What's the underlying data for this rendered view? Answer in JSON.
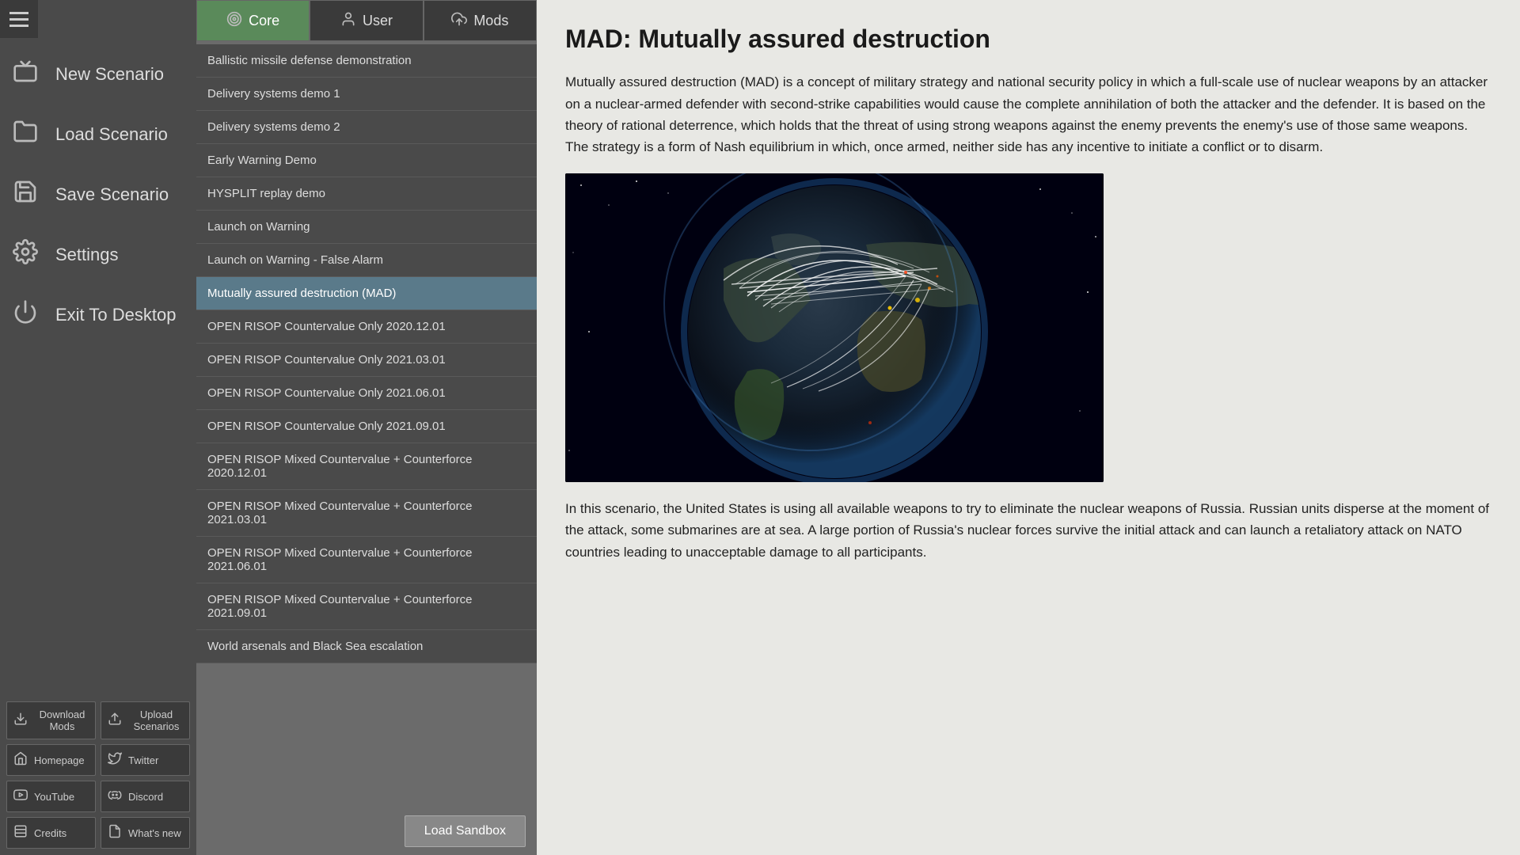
{
  "sidebar": {
    "nav_items": [
      {
        "id": "new-scenario",
        "label": "New Scenario",
        "icon": "box"
      },
      {
        "id": "load-scenario",
        "label": "Load Scenario",
        "icon": "folder"
      },
      {
        "id": "save-scenario",
        "label": "Save Scenario",
        "icon": "floppy"
      },
      {
        "id": "settings",
        "label": "Settings",
        "icon": "gear"
      },
      {
        "id": "exit-desktop",
        "label": "Exit To Desktop",
        "icon": "power"
      }
    ],
    "bottom_buttons": [
      [
        {
          "id": "download-mods",
          "label": "Download Mods",
          "icon": "download"
        },
        {
          "id": "upload-scenarios",
          "label": "Upload Scenarios",
          "icon": "upload"
        }
      ],
      [
        {
          "id": "homepage",
          "label": "Homepage",
          "icon": "home"
        },
        {
          "id": "twitter",
          "label": "Twitter",
          "icon": "twitter"
        }
      ],
      [
        {
          "id": "youtube",
          "label": "YouTube",
          "icon": "youtube"
        },
        {
          "id": "discord",
          "label": "Discord",
          "icon": "discord"
        }
      ],
      [
        {
          "id": "credits",
          "label": "Credits",
          "icon": "credits"
        },
        {
          "id": "whats-new",
          "label": "What's new",
          "icon": "document"
        }
      ]
    ]
  },
  "tabs": [
    {
      "id": "core",
      "label": "Core",
      "icon": "target",
      "active": true
    },
    {
      "id": "user",
      "label": "User",
      "icon": "user"
    },
    {
      "id": "mods",
      "label": "Mods",
      "icon": "cloud-upload"
    }
  ],
  "scenarios": [
    {
      "id": 1,
      "label": "Ballistic missile defense demonstration",
      "selected": false
    },
    {
      "id": 2,
      "label": "Delivery systems demo 1",
      "selected": false
    },
    {
      "id": 3,
      "label": "Delivery systems demo 2",
      "selected": false
    },
    {
      "id": 4,
      "label": "Early Warning Demo",
      "selected": false
    },
    {
      "id": 5,
      "label": "HYSPLIT replay demo",
      "selected": false
    },
    {
      "id": 6,
      "label": "Launch on Warning",
      "selected": false
    },
    {
      "id": 7,
      "label": "Launch on Warning - False Alarm",
      "selected": false
    },
    {
      "id": 8,
      "label": "Mutually assured destruction (MAD)",
      "selected": true
    },
    {
      "id": 9,
      "label": "OPEN RISOP Countervalue Only 2020.12.01",
      "selected": false
    },
    {
      "id": 10,
      "label": "OPEN RISOP Countervalue Only 2021.03.01",
      "selected": false
    },
    {
      "id": 11,
      "label": "OPEN RISOP Countervalue Only 2021.06.01",
      "selected": false
    },
    {
      "id": 12,
      "label": "OPEN RISOP Countervalue Only 2021.09.01",
      "selected": false
    },
    {
      "id": 13,
      "label": "OPEN RISOP Mixed Countervalue + Counterforce 2020.12.01",
      "selected": false
    },
    {
      "id": 14,
      "label": "OPEN RISOP Mixed Countervalue + Counterforce 2021.03.01",
      "selected": false
    },
    {
      "id": 15,
      "label": "OPEN RISOP Mixed Countervalue + Counterforce 2021.06.01",
      "selected": false
    },
    {
      "id": 16,
      "label": "OPEN RISOP Mixed Countervalue + Counterforce 2021.09.01",
      "selected": false
    },
    {
      "id": 17,
      "label": "World arsenals and Black Sea escalation",
      "selected": false
    }
  ],
  "load_sandbox_label": "Load Sandbox",
  "right_panel": {
    "title": "MAD: Mutually assured destruction",
    "description": "Mutually assured destruction (MAD) is a concept of military strategy and national security policy in which a full-scale use of nuclear weapons by an attacker on a nuclear-armed defender with second-strike capabilities would cause the complete annihilation of both the attacker and the defender. It is based on the theory of rational deterrence, which holds that the threat of using strong weapons against the enemy prevents the enemy's use of those same weapons. The strategy is a form of Nash equilibrium in which, once armed, neither side has any incentive to initiate a conflict or to disarm.",
    "scenario_detail": "In this scenario, the United States is using all available weapons to try to eliminate the nuclear weapons of Russia. Russian units disperse at the moment of the attack, some submarines are at sea. A large portion of Russia's nuclear forces survive the initial attack and can launch a retaliatory attack on NATO countries leading to unacceptable damage to all participants."
  }
}
